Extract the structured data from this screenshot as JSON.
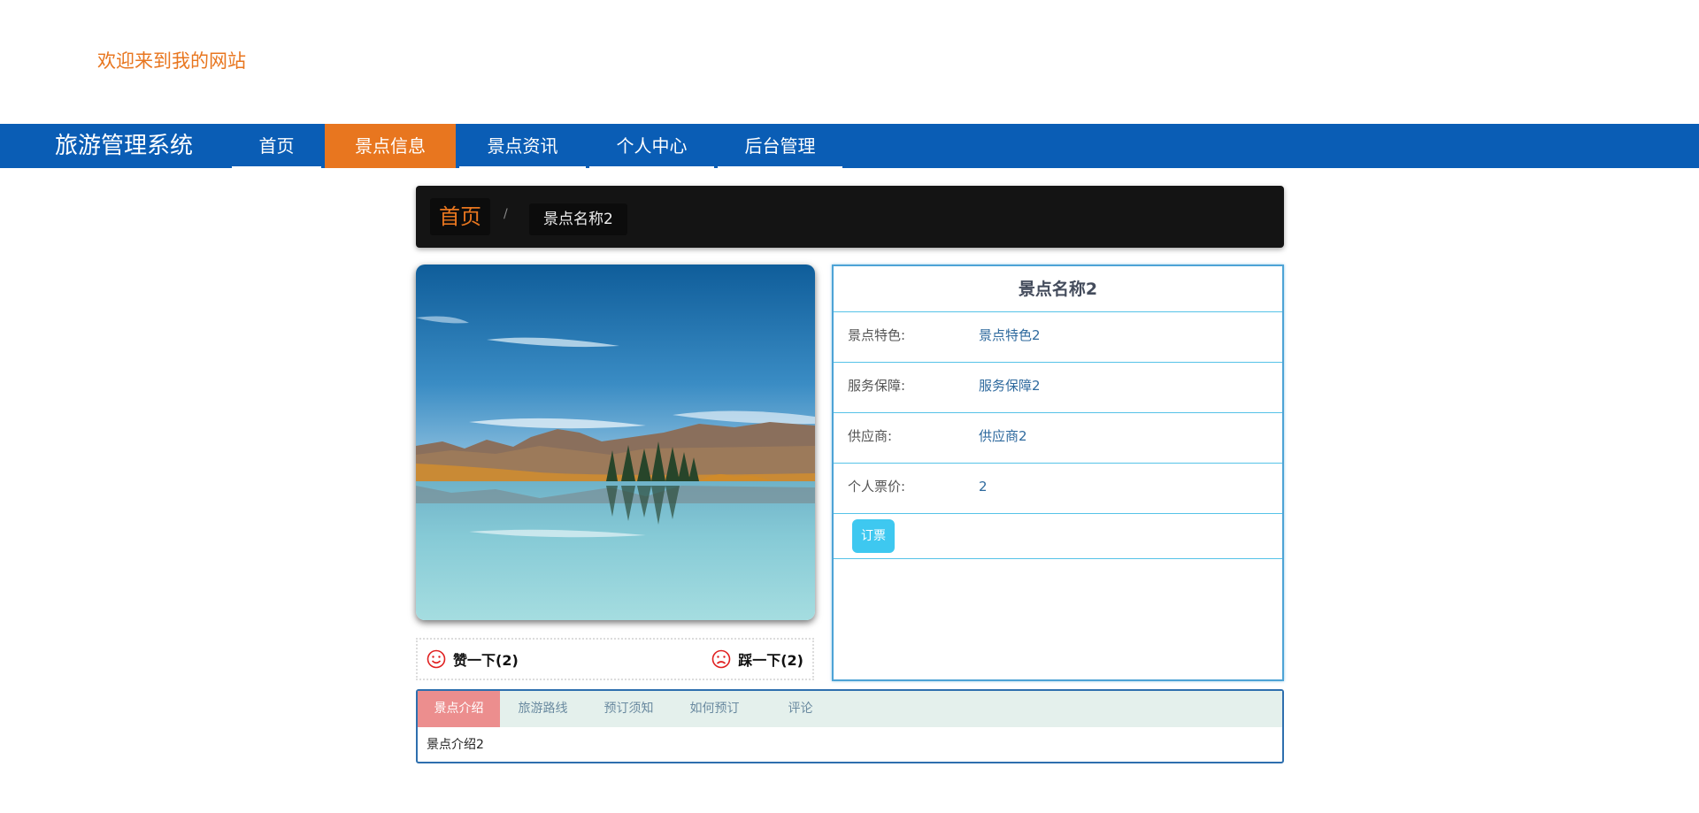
{
  "header": {
    "welcome": "欢迎来到我的网站"
  },
  "nav": {
    "brand": "旅游管理系统",
    "items": [
      {
        "label": "首页"
      },
      {
        "label": "景点信息",
        "active": true
      },
      {
        "label": "景点资讯"
      },
      {
        "label": "个人中心"
      },
      {
        "label": "后台管理"
      }
    ]
  },
  "breadcrumb": {
    "home": "首页",
    "separator": "/",
    "current": "景点名称2"
  },
  "photo": {
    "icon": "landscape-lake-mountains"
  },
  "reactions": {
    "like": "赞一下(2)",
    "dislike": "踩一下(2)"
  },
  "detail": {
    "title": "景点名称2",
    "rows": [
      {
        "key": "景点特色:",
        "value": "景点特色2"
      },
      {
        "key": "服务保障:",
        "value": "服务保障2"
      },
      {
        "key": "供应商:",
        "value": "供应商2"
      },
      {
        "key": "个人票价:",
        "value": "2"
      }
    ],
    "book_button": "订票"
  },
  "tabs": {
    "items": [
      {
        "label": "景点介绍",
        "active": true
      },
      {
        "label": "旅游路线"
      },
      {
        "label": "预订须知"
      },
      {
        "label": "如何预订"
      },
      {
        "label": "评论"
      }
    ],
    "content": "景点介绍2"
  },
  "colors": {
    "accent": "#e8761f",
    "nav": "#0a5db5",
    "panel_border": "#4da3d6",
    "tab_active": "#ec8e8e",
    "button": "#3ec8f0"
  }
}
